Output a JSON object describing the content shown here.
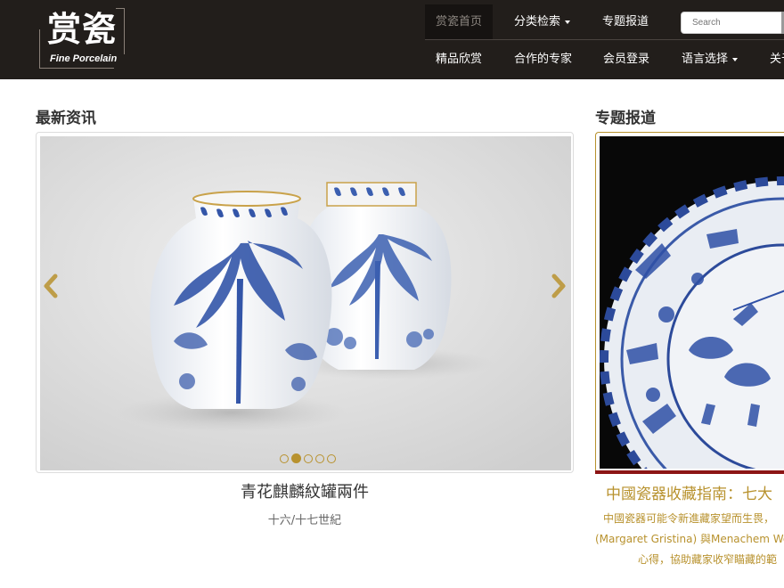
{
  "header": {
    "logo_cn": "赏瓷",
    "logo_en": "Fine Porcelain",
    "nav_row1": [
      {
        "label": "赏瓷首页",
        "active": true
      },
      {
        "label": "分类检索",
        "dropdown": true
      },
      {
        "label": "专题报道"
      }
    ],
    "nav_row2": [
      {
        "label": "精品欣赏"
      },
      {
        "label": "合作的专家"
      },
      {
        "label": "会员登录"
      },
      {
        "label": "语言选择",
        "dropdown": true
      },
      {
        "label": "关于"
      }
    ],
    "search": {
      "placeholder": "Search"
    }
  },
  "latest": {
    "section_title": "最新资讯",
    "slide_title": "青花麒麟紋罐兩件",
    "slide_subtitle": "十六/十七世紀",
    "dots_total": 5,
    "dots_active": 2
  },
  "feature": {
    "section_title": "专题报道",
    "title": "中國瓷器收藏指南：七大",
    "text_lines": [
      "中國瓷器可能令新進藏家望而生畏，",
      "(Margaret Gristina) 與Menachem We",
      "心得，協助藏家收窄瞄藏的範"
    ]
  },
  "colors": {
    "header_bg": "#221e1b",
    "accent_gold": "#b8922e",
    "accent_red": "#8c1515"
  },
  "icons": {
    "prev": "chevron-left-icon",
    "next": "chevron-right-icon"
  }
}
